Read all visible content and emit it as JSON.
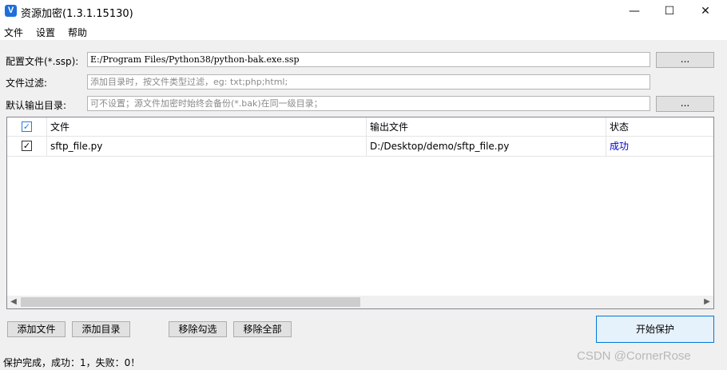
{
  "window": {
    "title": "资源加密(1.3.1.15130)",
    "icon_letter": "V",
    "controls": {
      "minimize": "—",
      "maximize": "☐",
      "close": "✕"
    }
  },
  "menu": {
    "file": "文件",
    "settings": "设置",
    "help": "帮助"
  },
  "form": {
    "config_label": "配置文件(*.ssp):",
    "config_value": "E:/Program Files/Python38/python-bak.exe.ssp",
    "browse_label": "...",
    "filter_label": "文件过滤:",
    "filter_placeholder": "添加目录时，按文件类型过滤，eg: txt;php;html;",
    "output_label": "默认输出目录:",
    "output_placeholder": "可不设置；源文件加密时始终会备份(*.bak)在同一级目录；",
    "output_browse_label": "..."
  },
  "table": {
    "columns": [
      "文件",
      "输出文件",
      "状态"
    ],
    "rows": [
      {
        "checked": true,
        "file": "sftp_file.py",
        "output": "D:/Desktop/demo/sftp_file.py",
        "status": "成功"
      }
    ]
  },
  "buttons": {
    "add_file": "添加文件",
    "add_dir": "添加目录",
    "remove_checked": "移除勾选",
    "remove_all": "移除全部",
    "start": "开始保护"
  },
  "status_text": "保护完成，成功：1，失败：0！",
  "watermark": "CSDN @CornerRose",
  "colors": {
    "accent": "#0078d7",
    "status_success": "#0000cc",
    "icon_bg": "#1e6fd9"
  }
}
